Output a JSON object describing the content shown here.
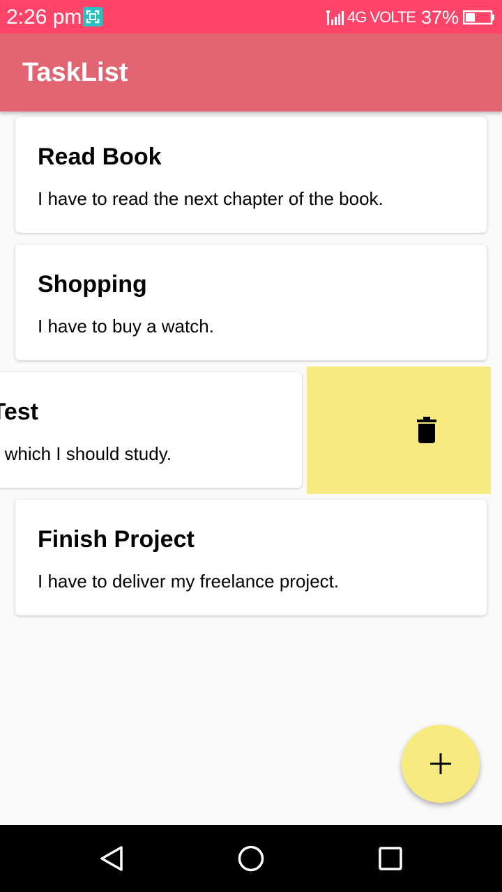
{
  "status_bar": {
    "time": "2:26 pm",
    "network": "4G VOLTE",
    "battery": "37%",
    "icons": [
      "screenshot-icon",
      "signal-icon",
      "battery-icon"
    ]
  },
  "app_bar": {
    "title": "TaskList"
  },
  "tasks": [
    {
      "title": "Read Book",
      "description": "I have to read the next chapter of the book."
    },
    {
      "title": "Shopping",
      "description": "I have to buy a watch."
    },
    {
      "title": "Test",
      "description": "which I should study.",
      "swiped": true
    },
    {
      "title": "Finish Project",
      "description": "I have to deliver my freelance project."
    }
  ],
  "swipe_action": {
    "icon": "trash-icon"
  },
  "fab": {
    "icon": "plus-icon"
  },
  "nav_bar": {
    "icons": [
      "back-icon",
      "home-icon",
      "recents-icon"
    ]
  },
  "colors": {
    "status_bar": "#ff4369",
    "app_bar": "#e06472",
    "accent": "#f7eb80",
    "background": "#fafafa"
  }
}
